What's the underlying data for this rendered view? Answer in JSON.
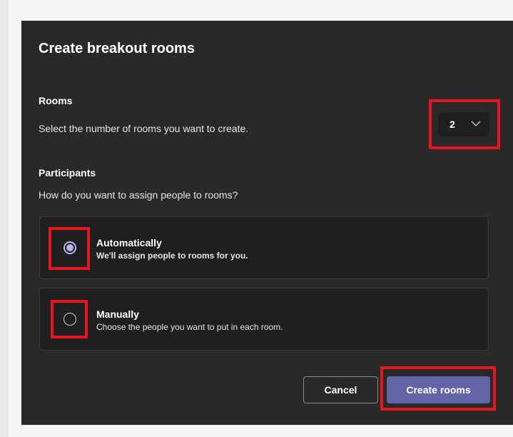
{
  "dialog": {
    "title": "Create breakout rooms",
    "rooms": {
      "label": "Rooms",
      "description": "Select the number of rooms you want to create.",
      "selected_count": "2"
    },
    "participants": {
      "label": "Participants",
      "description": "How do you want to assign people to rooms?",
      "options": [
        {
          "title": "Automatically",
          "subtitle": "We'll assign people to rooms for you.",
          "selected": true
        },
        {
          "title": "Manually",
          "subtitle": "Choose the people you want to put in each room.",
          "selected": false
        }
      ]
    },
    "buttons": {
      "cancel": "Cancel",
      "create": "Create rooms"
    }
  },
  "colors": {
    "dialog_bg": "#292929",
    "card_bg": "#1f1f1f",
    "accent": "#6264a7",
    "radio_selected": "#b7b5ee",
    "highlight": "#e8141e"
  },
  "icons": {
    "dropdown": "chevron-down-icon"
  }
}
